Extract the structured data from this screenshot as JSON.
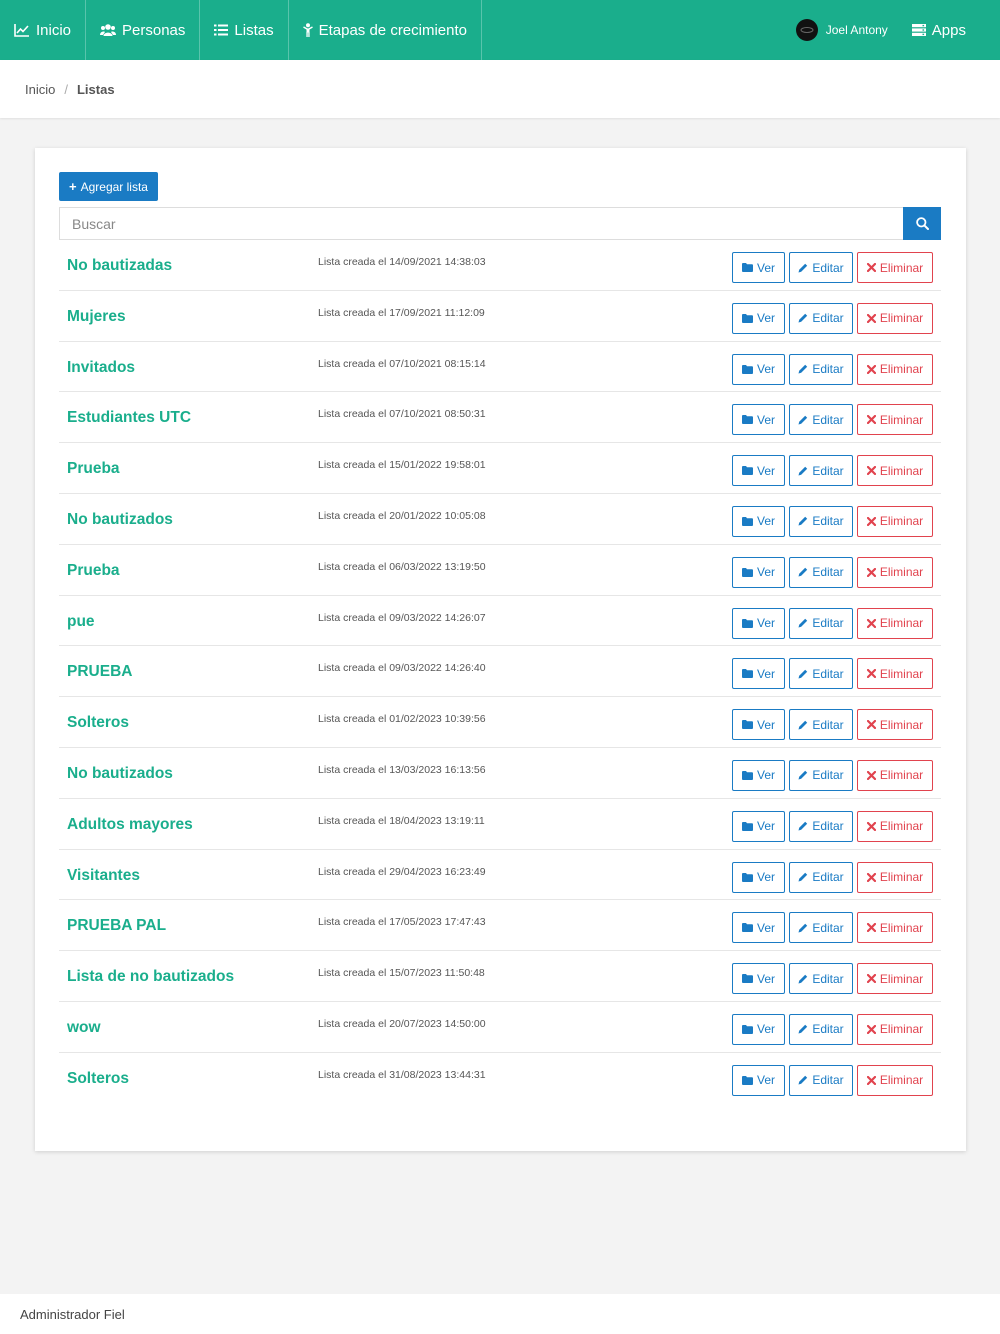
{
  "nav": {
    "items": [
      {
        "label": "Inicio",
        "icon": "line-chart-icon"
      },
      {
        "label": "Personas",
        "icon": "users-icon"
      },
      {
        "label": "Listas",
        "icon": "list-icon"
      },
      {
        "label": "Etapas de crecimiento",
        "icon": "child-icon"
      }
    ],
    "user": "Joel Antony",
    "apps": "Apps"
  },
  "breadcrumb": {
    "home": "Inicio",
    "separator": "/",
    "current": "Listas"
  },
  "toolbar": {
    "add_label": "Agregar lista",
    "search_placeholder": "Buscar"
  },
  "buttons": {
    "ver": "Ver",
    "editar": "Editar",
    "eliminar": "Eliminar"
  },
  "lists": [
    {
      "name": "No bautizadas",
      "created": "Lista creada el 14/09/2021 14:38:03"
    },
    {
      "name": "Mujeres",
      "created": "Lista creada el 17/09/2021 11:12:09"
    },
    {
      "name": "Invitados",
      "created": "Lista creada el 07/10/2021 08:15:14"
    },
    {
      "name": "Estudiantes UTC",
      "created": "Lista creada el 07/10/2021 08:50:31"
    },
    {
      "name": "Prueba",
      "created": "Lista creada el 15/01/2022 19:58:01"
    },
    {
      "name": "No bautizados",
      "created": "Lista creada el 20/01/2022 10:05:08"
    },
    {
      "name": "Prueba",
      "created": "Lista creada el 06/03/2022 13:19:50"
    },
    {
      "name": "pue",
      "created": "Lista creada el 09/03/2022 14:26:07"
    },
    {
      "name": "PRUEBA",
      "created": "Lista creada el 09/03/2022 14:26:40"
    },
    {
      "name": "Solteros",
      "created": "Lista creada el 01/02/2023 10:39:56"
    },
    {
      "name": "No bautizados",
      "created": "Lista creada el 13/03/2023 16:13:56"
    },
    {
      "name": "Adultos mayores",
      "created": "Lista creada el 18/04/2023 13:19:11"
    },
    {
      "name": "Visitantes",
      "created": "Lista creada el 29/04/2023 16:23:49"
    },
    {
      "name": "PRUEBA PAL",
      "created": "Lista creada el 17/05/2023 17:47:43"
    },
    {
      "name": "Lista de no bautizados",
      "created": "Lista creada el 15/07/2023 11:50:48"
    },
    {
      "name": "wow",
      "created": "Lista creada el 20/07/2023 14:50:00"
    },
    {
      "name": "Solteros",
      "created": "Lista creada el 31/08/2023 13:44:31"
    }
  ],
  "footer": {
    "text": "Administrador Fiel"
  },
  "colors": {
    "brand": "#1aae8c",
    "primary": "#1a7bc4",
    "danger": "#e1434e"
  }
}
